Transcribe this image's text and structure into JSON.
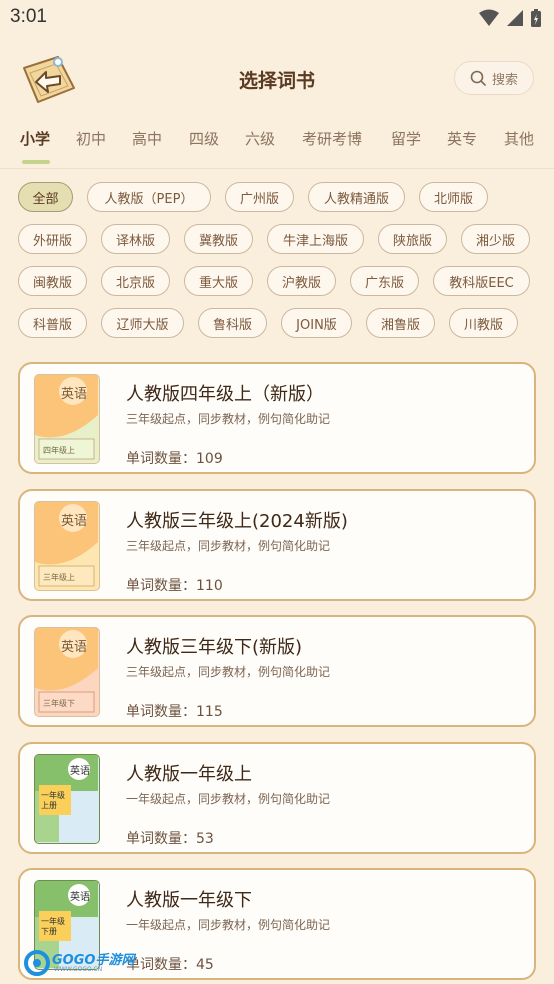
{
  "status_bar": {
    "time": "3:01"
  },
  "header": {
    "title": "选择词书",
    "search_label": "搜索"
  },
  "tabs": [
    "小学",
    "初中",
    "高中",
    "四级",
    "六级",
    "考研考博",
    "留学",
    "英专",
    "其他"
  ],
  "filters": [
    "全部",
    "人教版（PEP）",
    "广州版",
    "人教精通版",
    "北师版",
    "外研版",
    "译林版",
    "冀教版",
    "牛津上海版",
    "陕旅版",
    "湘少版",
    "闽教版",
    "北京版",
    "重大版",
    "沪教版",
    "广东版",
    "教科版EEC",
    "科普版",
    "辽师大版",
    "鲁科版",
    "JOIN版",
    "湘鲁版",
    "川教版"
  ],
  "books": [
    {
      "title": "人教版四年级上（新版）",
      "subtitle": "三年级起点，同步教材，例句简化助记",
      "count": "单词数量：109",
      "cover_word": "英语",
      "cover_label": "四年级上"
    },
    {
      "title": "人教版三年级上(2024新版)",
      "subtitle": "三年级起点，同步教材，例句简化助记",
      "count": "单词数量：110",
      "cover_word": "英语",
      "cover_label": "三年级上"
    },
    {
      "title": "人教版三年级下(新版)",
      "subtitle": "三年级起点，同步教材，例句简化助记",
      "count": "单词数量：115",
      "cover_word": "英语",
      "cover_label": "三年级下"
    },
    {
      "title": "人教版一年级上",
      "subtitle": "一年级起点，同步教材，例句简化助记",
      "count": "单词数量：53",
      "cover_word": "英语",
      "cover_label": "一年级上册"
    },
    {
      "title": "人教版一年级下",
      "subtitle": "一年级起点，同步教材，例句简化助记",
      "count": "单词数量：45",
      "cover_word": "英语",
      "cover_label": "一年级下册"
    }
  ],
  "watermark": {
    "brand": "GOGO手游网",
    "url": "WWW.GOGO.CN"
  },
  "colors": {
    "background": "#faeedd",
    "card_border": "#d8b57e",
    "active_chip": "#e5deb1",
    "tab_underline": "#c4d48f"
  }
}
